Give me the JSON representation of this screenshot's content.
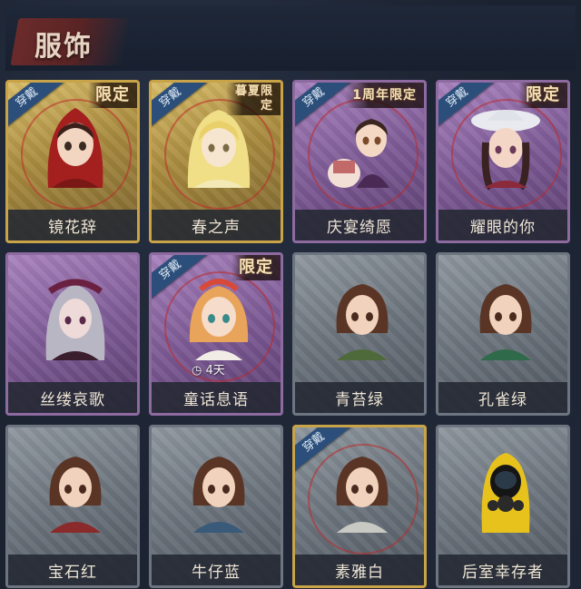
{
  "header": {
    "title": "服饰"
  },
  "cards": [
    {
      "name": "镜花辞",
      "rarity": "gold",
      "equipped_label": "穿戴",
      "badge": "限定"
    },
    {
      "name": "春之声",
      "rarity": "gold",
      "equipped_label": "穿戴",
      "badge": "暮夏限定"
    },
    {
      "name": "庆宴绮愿",
      "rarity": "purple",
      "equipped_label": "穿戴",
      "badge": "1周年限定"
    },
    {
      "name": "耀眼的你",
      "rarity": "purple",
      "equipped_label": "穿戴",
      "badge": "限定"
    },
    {
      "name": "丝缕哀歌",
      "rarity": "purple"
    },
    {
      "name": "童话息语",
      "rarity": "purple",
      "equipped_label": "穿戴",
      "badge": "限定",
      "timer": "4天"
    },
    {
      "name": "青苔绿",
      "rarity": "gray"
    },
    {
      "name": "孔雀绿",
      "rarity": "gray"
    },
    {
      "name": "宝石红",
      "rarity": "gray"
    },
    {
      "name": "牛仔蓝",
      "rarity": "gray"
    },
    {
      "name": "素雅白",
      "rarity": "gray",
      "equipped_label": "穿戴"
    },
    {
      "name": "后室幸存者",
      "rarity": "gray"
    }
  ],
  "colors": {
    "gold_frame": "#c9a347",
    "purple_frame": "#8d6aa0",
    "gray_frame": "#6d7580",
    "equipped_tag": "#2b4f7a",
    "title_plate": "#6b2b2b"
  }
}
